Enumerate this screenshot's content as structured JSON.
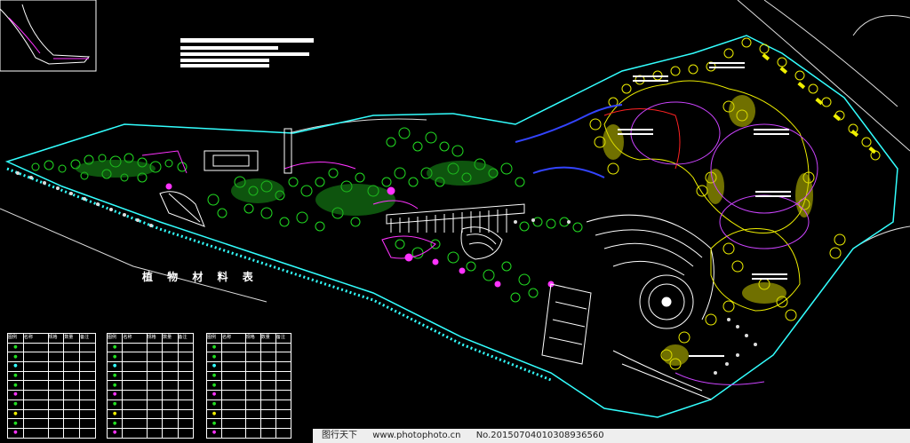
{
  "title": "植 物 材 料 表",
  "watermark": {
    "left": "图行天下",
    "url": "www.photophoto.cn",
    "id": "No.20150704010308936560"
  },
  "legend_headers": [
    "图例",
    "名称",
    "规格",
    "数量",
    "备注"
  ],
  "colors": {
    "background": "#000000",
    "tree_green": "#22dd22",
    "tree_yellow": "#eeee00",
    "magenta": "#ff33ff",
    "cyan": "#33ffff",
    "blue": "#3344ff",
    "white": "#ffffff",
    "red": "#ff2222"
  }
}
